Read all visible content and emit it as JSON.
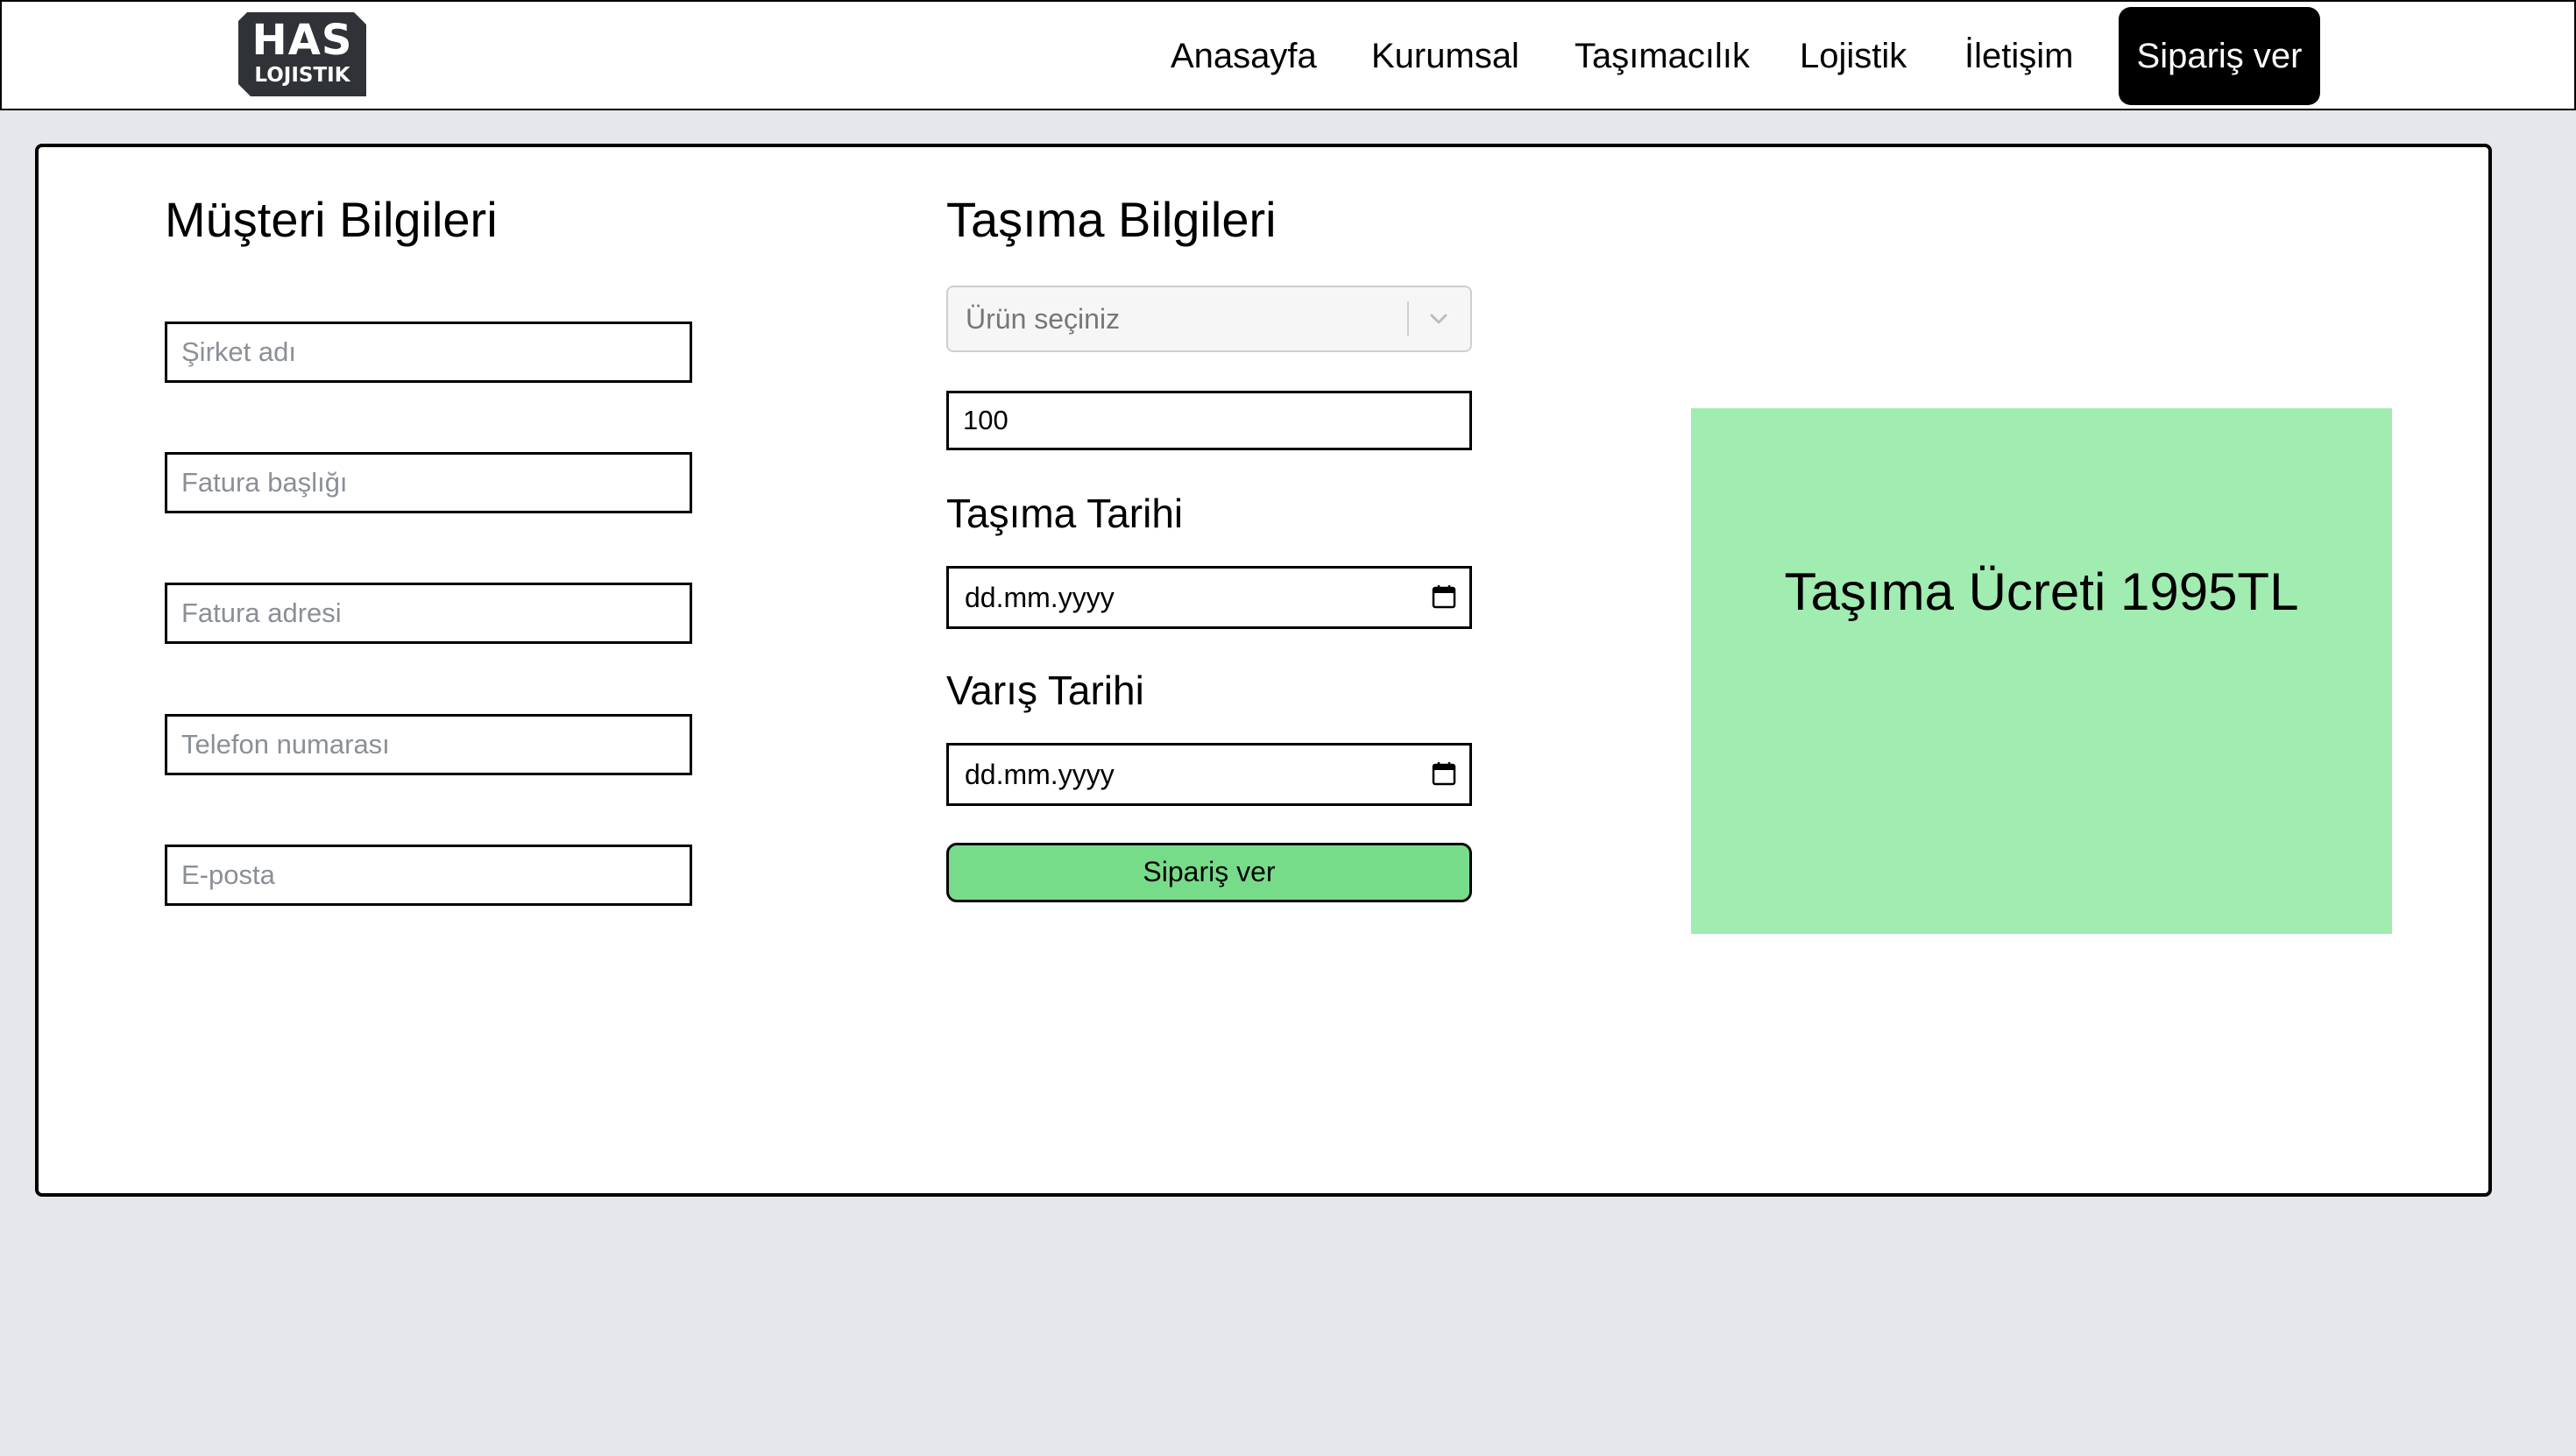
{
  "header": {
    "logo": {
      "line1": "HAS",
      "line2": "LOJISTIK"
    },
    "nav": [
      {
        "label": "Anasayfa"
      },
      {
        "label": "Kurumsal"
      },
      {
        "label": "Taşımacılık"
      },
      {
        "label": "Lojistik"
      },
      {
        "label": "İletişim"
      }
    ],
    "cta_label": "Sipariş ver"
  },
  "customer": {
    "title": "Müşteri Bilgileri",
    "fields": {
      "company": {
        "placeholder": "Şirket adı",
        "value": ""
      },
      "invoice_title": {
        "placeholder": "Fatura başlığı",
        "value": ""
      },
      "invoice_address": {
        "placeholder": "Fatura adresi",
        "value": ""
      },
      "phone": {
        "placeholder": "Telefon numarası",
        "value": ""
      },
      "email": {
        "placeholder": "E-posta",
        "value": ""
      }
    }
  },
  "shipping": {
    "title": "Taşıma Bilgileri",
    "product_select": {
      "placeholder": "Ürün seçiniz",
      "icon": "chevron-down-icon"
    },
    "quantity": {
      "value": "100"
    },
    "ship_date": {
      "label": "Taşıma Tarihi",
      "value": "dd.mm.yyyy",
      "icon": "calendar-icon"
    },
    "arrival_date": {
      "label": "Varış Tarihi",
      "value": "dd.mm.yyyy",
      "icon": "calendar-icon"
    },
    "submit_label": "Sipariş ver"
  },
  "price": {
    "text": "Taşıma Ücreti 1995TL",
    "box_color": "#a1ecb0"
  },
  "colors": {
    "page_bg": "#e5e7eb",
    "button_green": "#77dc8a",
    "cta_bg": "#000000"
  }
}
